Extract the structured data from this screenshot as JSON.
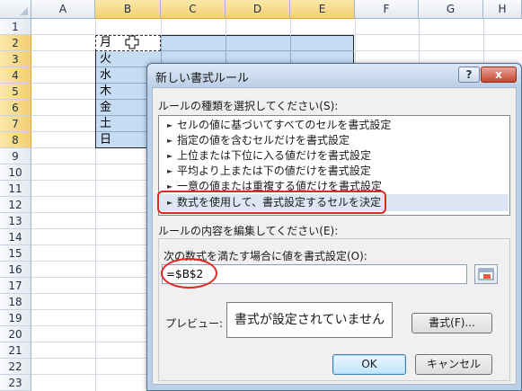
{
  "sheet": {
    "columns": [
      "A",
      "B",
      "C",
      "D",
      "E",
      "F",
      "G",
      "H"
    ],
    "rows": [
      "1",
      "2",
      "3",
      "4",
      "5",
      "6",
      "7",
      "8",
      "9",
      "10",
      "11",
      "12",
      "13",
      "14",
      "15",
      "16",
      "17",
      "18",
      "19",
      "20",
      "21",
      "22",
      "23"
    ],
    "selected_columns": [
      "B",
      "C",
      "D",
      "E"
    ],
    "selected_rows": [
      "2",
      "3",
      "4",
      "5",
      "6",
      "7",
      "8"
    ],
    "cells_B": [
      "月",
      "火",
      "水",
      "木",
      "金",
      "土",
      "日"
    ]
  },
  "dialog": {
    "title": "新しい書式ルール",
    "help_label": "?",
    "close_label": "x",
    "select_type_label": "ルールの種類を選択してください(S):",
    "rule_types": [
      "セルの値に基づいてすべてのセルを書式設定",
      "指定の値を含むセルだけを書式設定",
      "上位または下位に入る値だけを書式設定",
      "平均より上または下の値だけを書式設定",
      "一意の値または重複する値だけを書式設定",
      "数式を使用して、書式設定するセルを決定"
    ],
    "edit_label": "ルールの内容を編集してください(E):",
    "formula_label": "次の数式を満たす場合に値を書式設定(O):",
    "formula_value": "=$B$2",
    "preview_label": "プレビュー:",
    "preview_text": "書式が設定されていません",
    "format_button": "書式(F)...",
    "ok_button": "OK",
    "cancel_button": "キャンセル"
  },
  "colors": {
    "selection_fill": "#c5dcf3",
    "highlight_red": "#e2281e",
    "dialog_frame": "#bcd0e8"
  }
}
